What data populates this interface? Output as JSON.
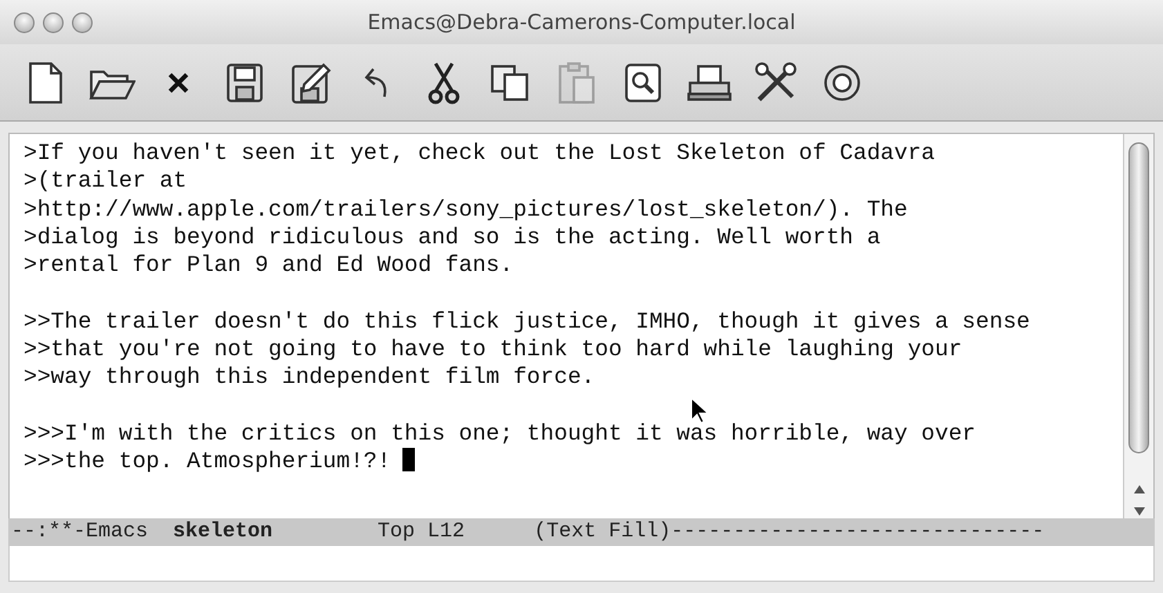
{
  "window": {
    "title": "Emacs@Debra-Camerons-Computer.local"
  },
  "toolbar": [
    {
      "kind": "new",
      "disabled": false
    },
    {
      "kind": "open",
      "disabled": false
    },
    {
      "kind": "close",
      "disabled": false
    },
    {
      "kind": "save",
      "disabled": false
    },
    {
      "kind": "saveas",
      "disabled": false
    },
    {
      "kind": "undo",
      "disabled": false
    },
    {
      "kind": "cut",
      "disabled": false
    },
    {
      "kind": "copy",
      "disabled": false
    },
    {
      "kind": "paste",
      "disabled": true
    },
    {
      "kind": "search",
      "disabled": false
    },
    {
      "kind": "print",
      "disabled": false
    },
    {
      "kind": "tools",
      "disabled": false
    },
    {
      "kind": "help",
      "disabled": false
    }
  ],
  "buffer": {
    "paragraphs": [
      [
        ">If you haven't seen it yet, check out the Lost Skeleton of Cadavra",
        ">(trailer at",
        ">http://www.apple.com/trailers/sony_pictures/lost_skeleton/). The",
        ">dialog is beyond ridiculous and so is the acting. Well worth a",
        ">rental for Plan 9 and Ed Wood fans."
      ],
      [
        ">>The trailer doesn't do this flick justice, IMHO, though it gives a sense",
        ">>that you're not going to have to think too hard while laughing your",
        ">>way through this independent film force."
      ],
      [
        ">>>I'm with the critics on this one; thought it was horrible, way over",
        ">>>the top. Atmospherium!?!"
      ]
    ]
  },
  "mode_line": [
    {
      "kind": "status",
      "text": "--:**-Emacs"
    },
    {
      "kind": "buffer",
      "text": "skeleton"
    },
    {
      "kind": "position",
      "text": "Top L12"
    },
    {
      "kind": "mode",
      "text": "(Text Fill)------------------------------"
    }
  ]
}
